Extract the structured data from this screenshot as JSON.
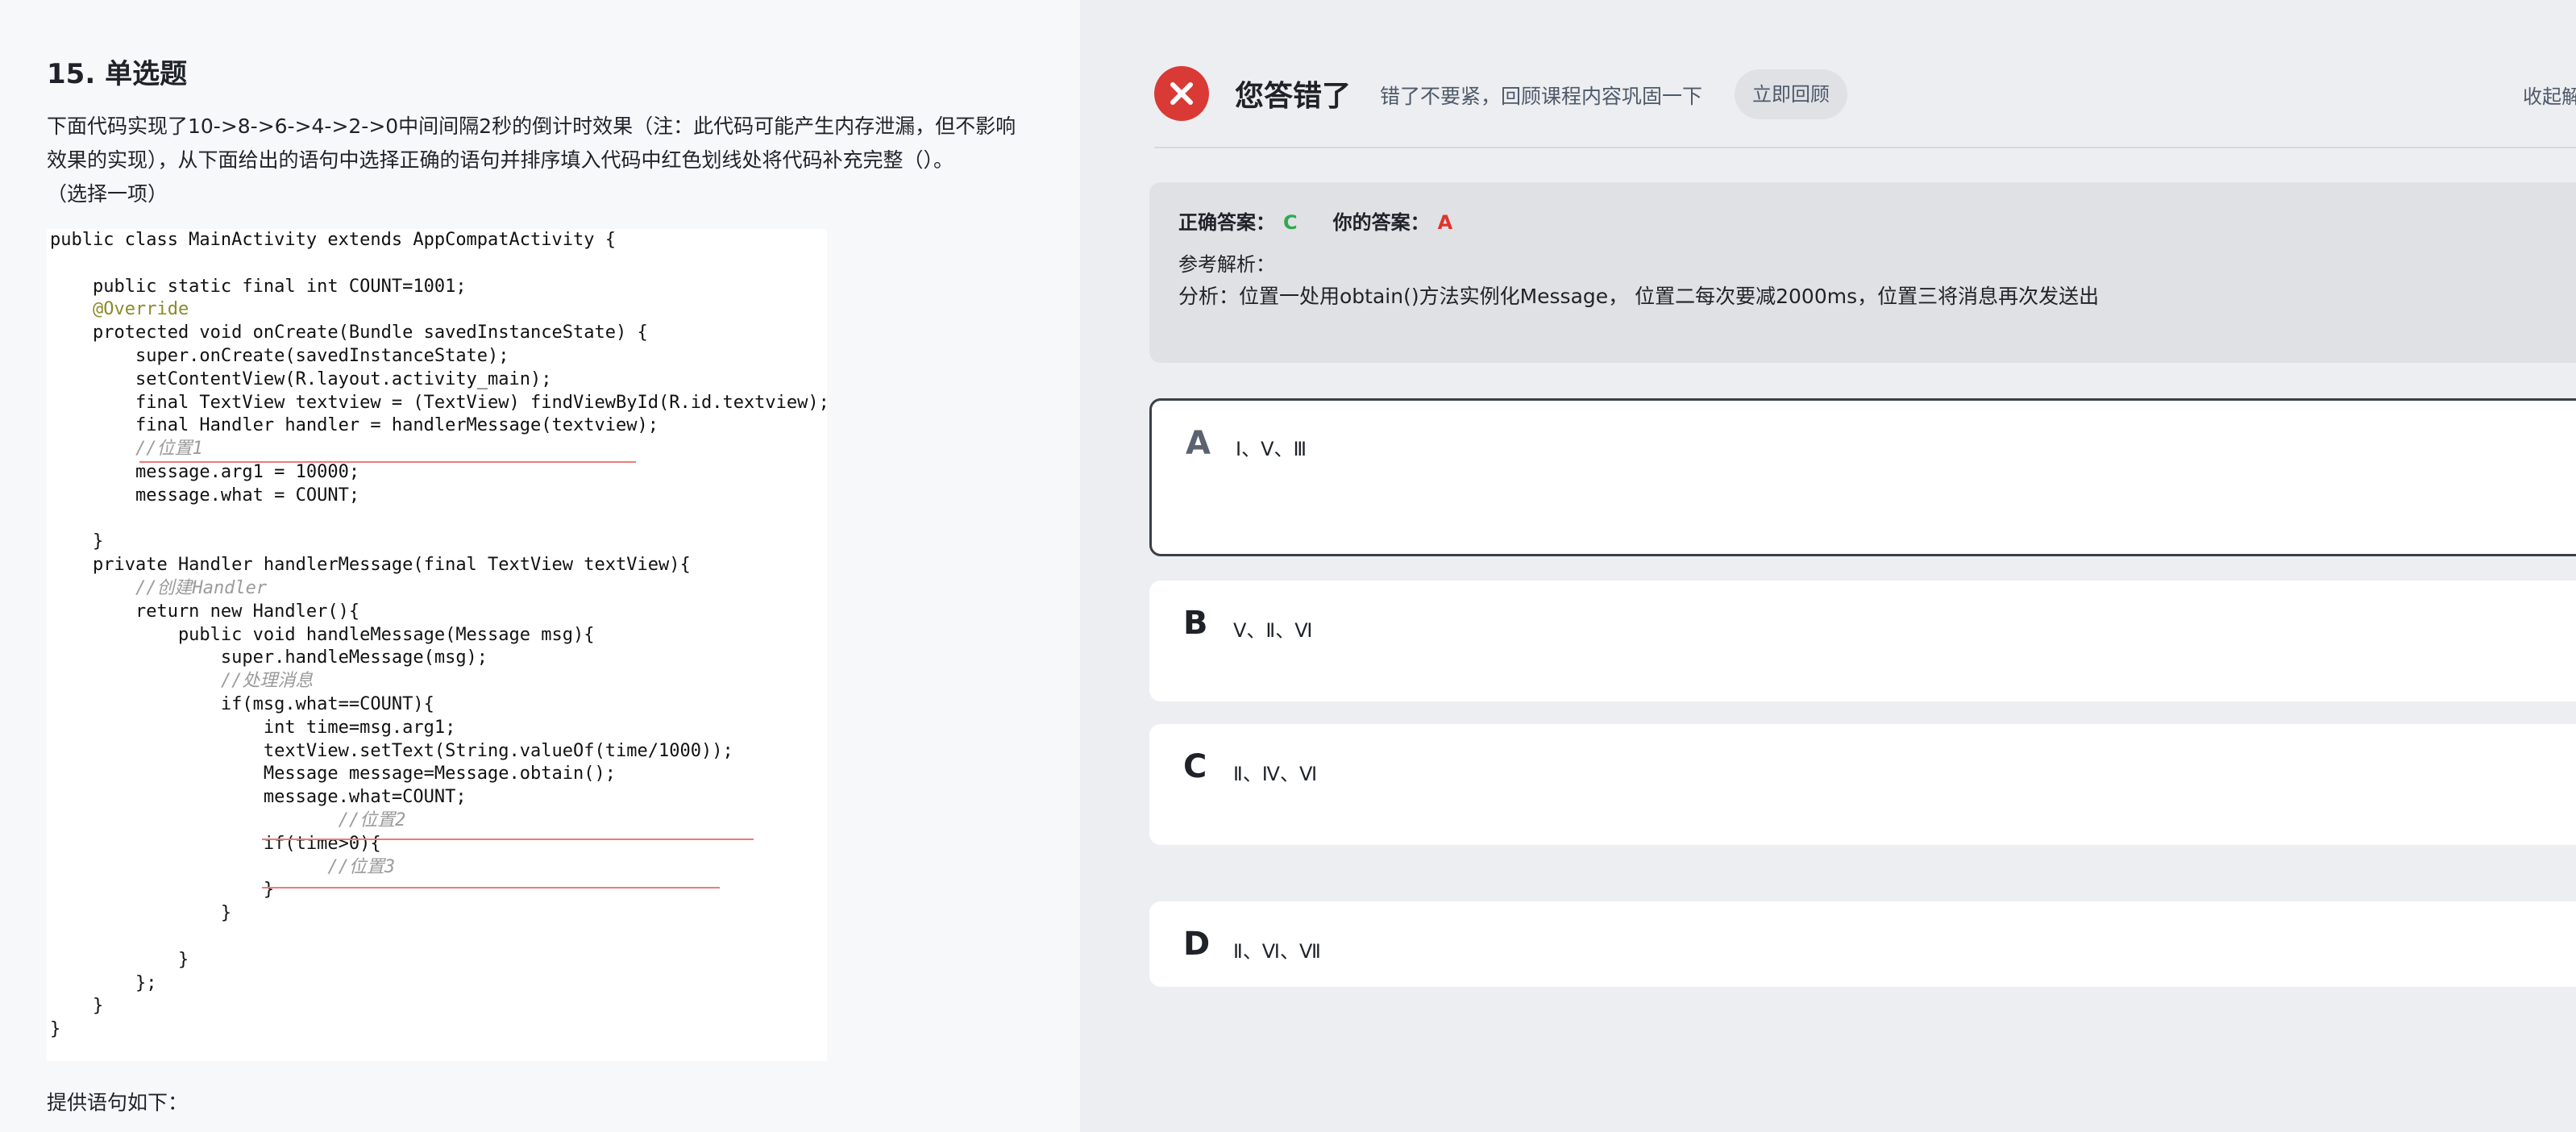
{
  "question": {
    "title": "15. 单选题",
    "body": "下面代码实现了10->8->6->4->2->0中间间隔2秒的倒计时效果（注：此代码可能产生内存泄漏，但不影响效果的实现），从下面给出的语句中选择正确的语句并排序填入代码中红色划线处将代码补充完整（）。",
    "note": "（选择一项）",
    "footer": "提供语句如下：",
    "code_lines": [
      "public class MainActivity extends AppCompatActivity {",
      "",
      "    public static final int COUNT=1001;",
      "    @Override",
      "    protected void onCreate(Bundle savedInstanceState) {",
      "        super.onCreate(savedInstanceState);",
      "        setContentView(R.layout.activity_main);",
      "        final TextView textview = (TextView) findViewById(R.id.textview);",
      "        final Handler handler = handlerMessage(textview);",
      "        //位置1",
      "        message.arg1 = 10000;",
      "        message.what = COUNT;",
      "",
      "    }",
      "    private Handler handlerMessage(final TextView textView){",
      "        //创建Handler",
      "        return new Handler(){",
      "            public void handleMessage(Message msg){",
      "                super.handleMessage(msg);",
      "                //处理消息",
      "                if(msg.what==COUNT){",
      "                    int time=msg.arg1;",
      "                    textView.setText(String.valueOf(time/1000));",
      "                    Message message=Message.obtain();",
      "                    message.what=COUNT;",
      "                           //位置2",
      "                    if(time>0){",
      "                          //位置3",
      "                    }",
      "                }",
      "",
      "            }",
      "        };",
      "    }",
      "}"
    ]
  },
  "result": {
    "status_title": "您答错了",
    "status_sub": "错了不要紧，回顾课程内容巩固一下",
    "review_button": "立即回顾",
    "collapse": "收起解析",
    "correct_label": "正确答案：",
    "correct_value": "C",
    "yours_label": "你的答案：",
    "yours_value": "A",
    "reference_label": "参考解析：",
    "analysis": "分析：位置一处用obtain()方法实例化Message， 位置二每次要减2000ms，位置三将消息再次发送出"
  },
  "options": [
    {
      "letter": "A",
      "text": "Ⅰ、Ⅴ、Ⅲ",
      "selected": true
    },
    {
      "letter": "B",
      "text": "Ⅴ、Ⅱ、Ⅵ",
      "selected": false
    },
    {
      "letter": "C",
      "text": "Ⅱ、Ⅳ、Ⅵ",
      "selected": false
    },
    {
      "letter": "D",
      "text": "Ⅱ、Ⅵ、Ⅶ",
      "selected": false
    }
  ],
  "colors": {
    "wrong": "#d93a35",
    "correct": "#2fa84f",
    "yours": "#e0332b"
  },
  "icons": {
    "status": "close-circle-icon"
  }
}
